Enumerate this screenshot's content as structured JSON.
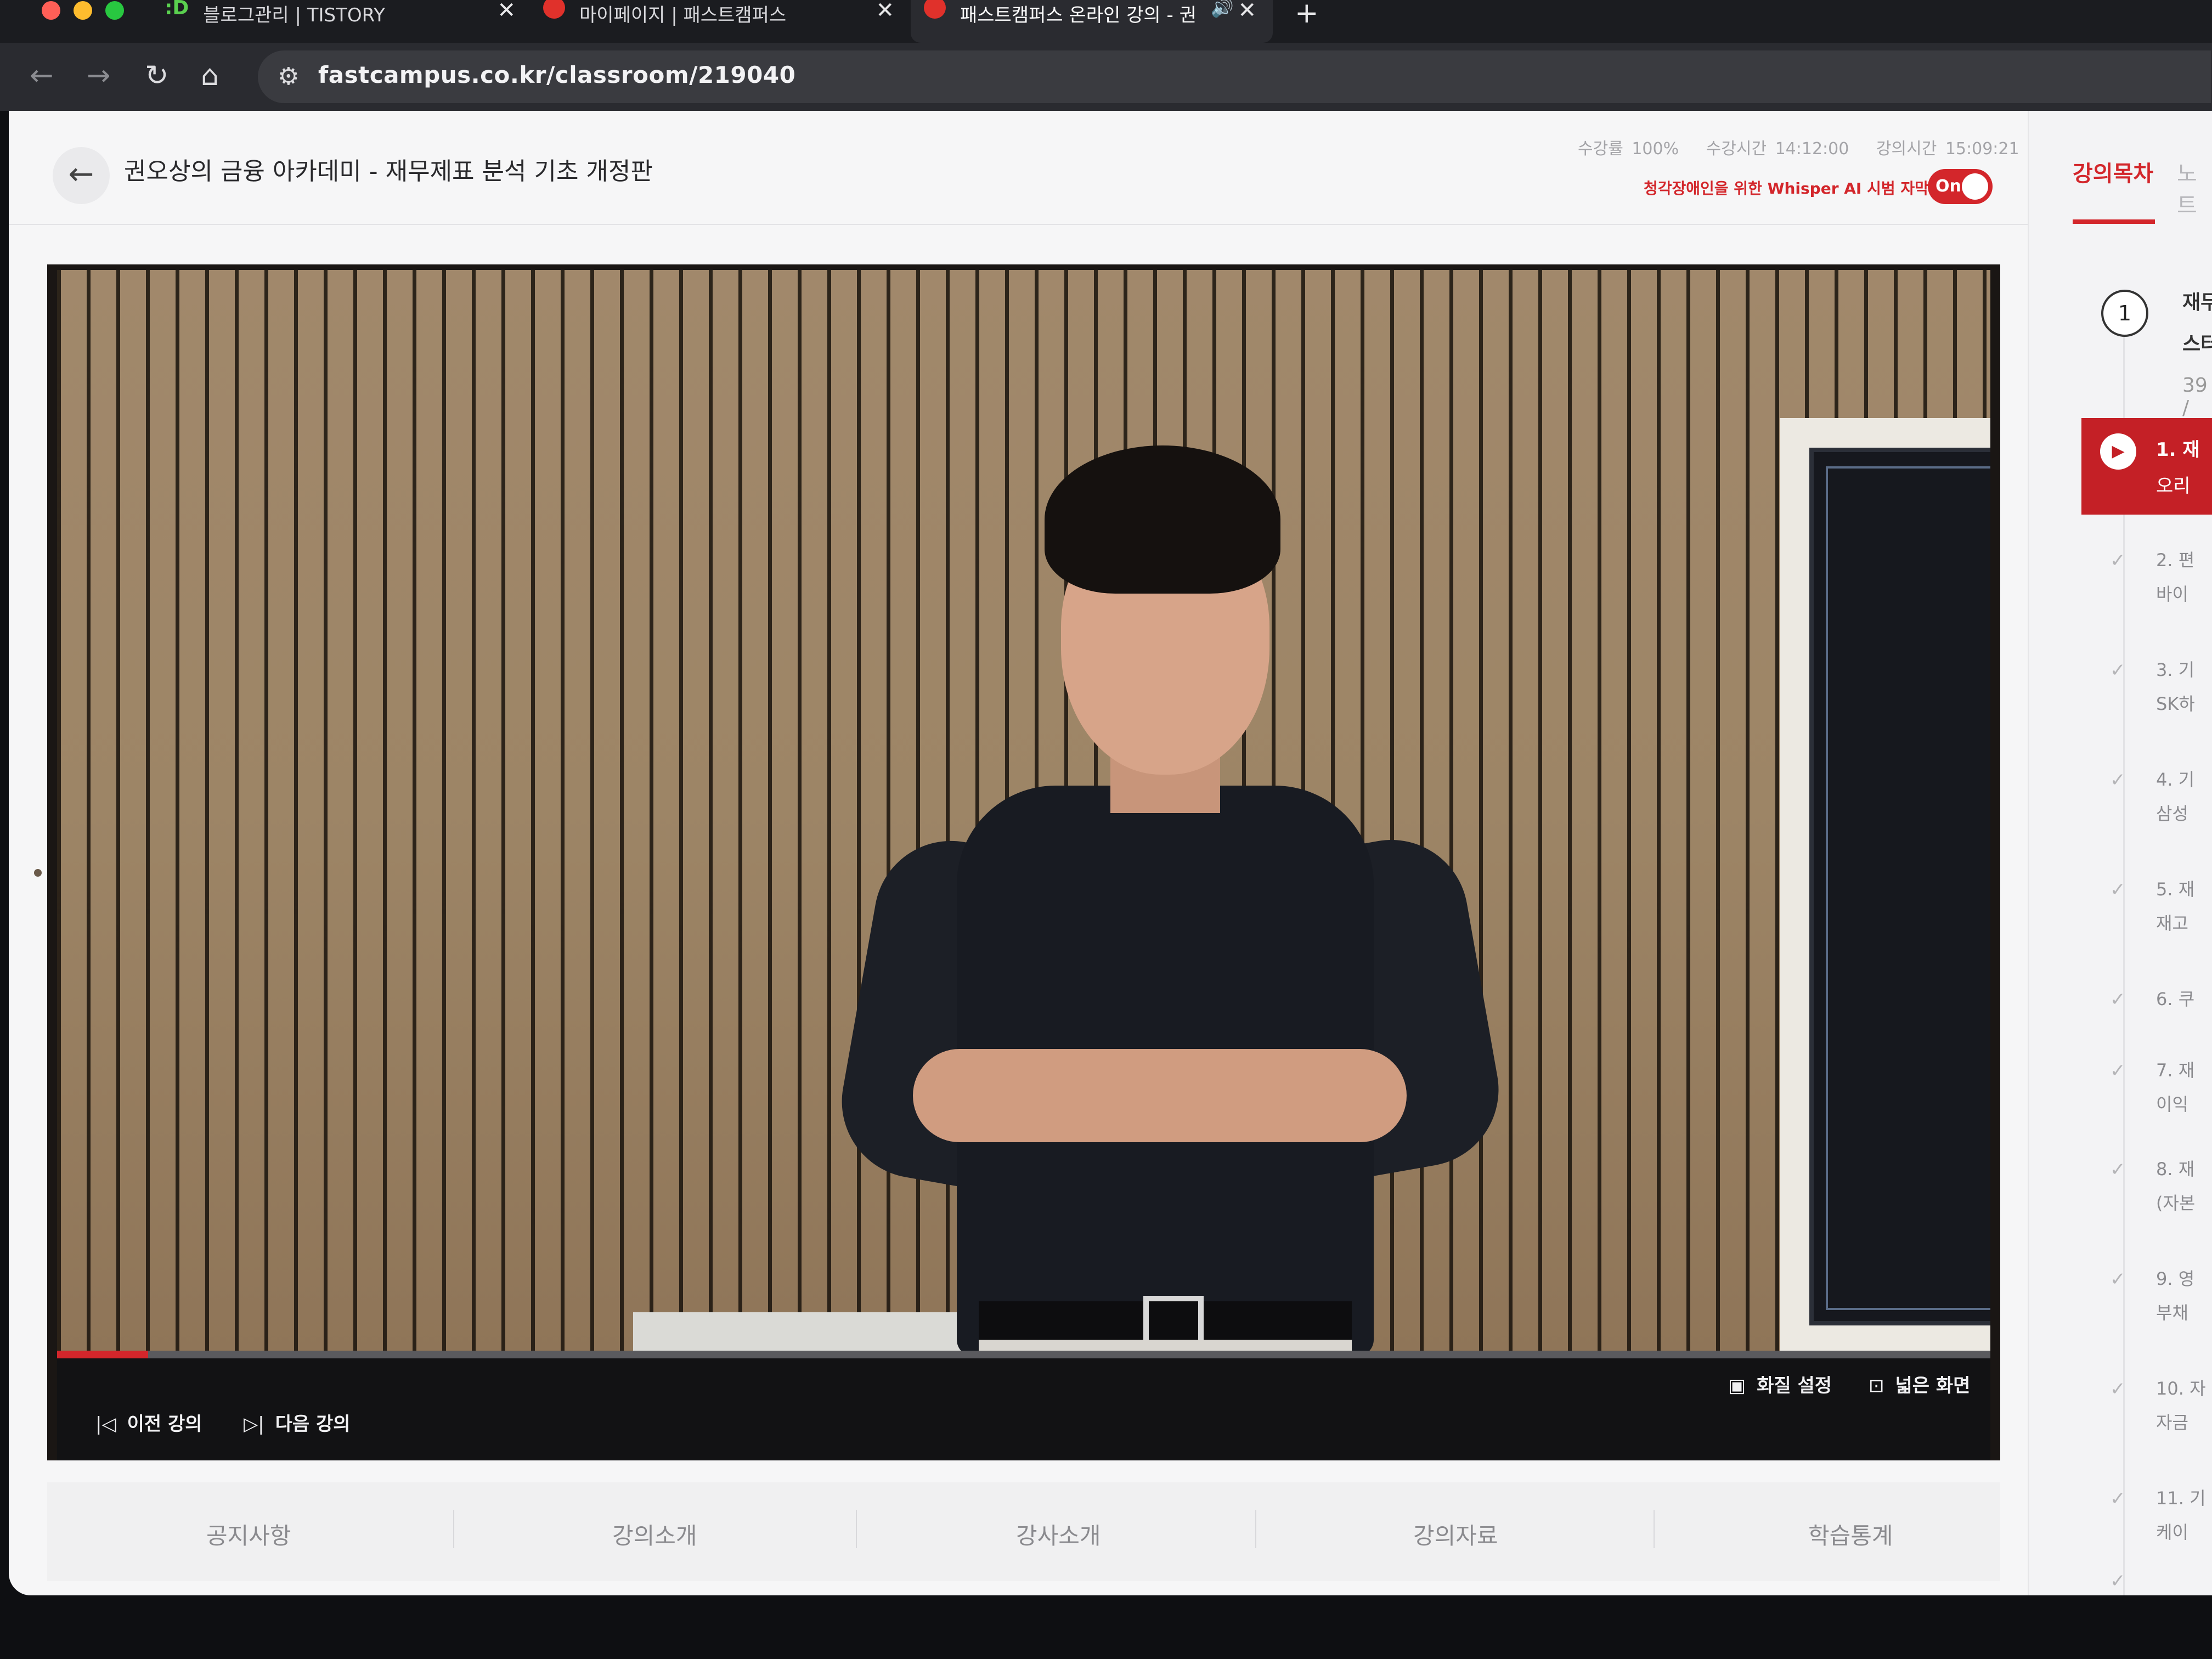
{
  "browser": {
    "tabs": [
      {
        "favicon": ":D",
        "title": "블로그관리 | TISTORY"
      },
      {
        "title": "마이페이지 | 패스트캠퍼스"
      },
      {
        "title": "패스트캠퍼스 온라인 강의 - 권",
        "audio": "🔊"
      }
    ],
    "url": "fastcampus.co.kr/classroom/219040"
  },
  "header": {
    "course_title": "권오상의 금융 아카데미 - 재무제표 분석 기초 개정판",
    "completion": "수강률 100%",
    "watch_time": "수강시간 14:12:00",
    "lecture_time": "강의시간 15:09:21",
    "whisper_label": "청각장애인을 위한 Whisper AI 시범 자막",
    "toggle_label": "On",
    "toggle_state": true
  },
  "sidebar": {
    "tabs": [
      "강의목차",
      "노트"
    ],
    "chapter_number": "1",
    "chapter_title_line1": "재무",
    "chapter_title_line2": "스터",
    "chapter_duration": "39 /",
    "active_lesson": {
      "line1": "1. 재",
      "line2": "오리"
    },
    "lessons": [
      {
        "line1": "2. 편",
        "line2": "바이"
      },
      {
        "line1": "3. 기",
        "line2": "SK하"
      },
      {
        "line1": "4. 기",
        "line2": "삼성"
      },
      {
        "line1": "5. 재",
        "line2": "재고"
      },
      {
        "line1": "6. 쿠",
        "line2": ""
      },
      {
        "line1": "7. 재",
        "line2": "이익"
      },
      {
        "line1": "8. 재",
        "line2": "(자본"
      },
      {
        "line1": "9. 영",
        "line2": "부채"
      },
      {
        "line1": "10. 자",
        "line2": "자금"
      },
      {
        "line1": "11. 기",
        "line2": "케이"
      }
    ]
  },
  "player": {
    "progress": 0.047,
    "prev_label": "이전 강의",
    "next_label": "다음 강의",
    "quality_label": "화질 설정",
    "wide_label": "넓은 화면"
  },
  "bottom_nav": [
    "공지사항",
    "강의소개",
    "강사소개",
    "강의자료",
    "학습통계"
  ]
}
